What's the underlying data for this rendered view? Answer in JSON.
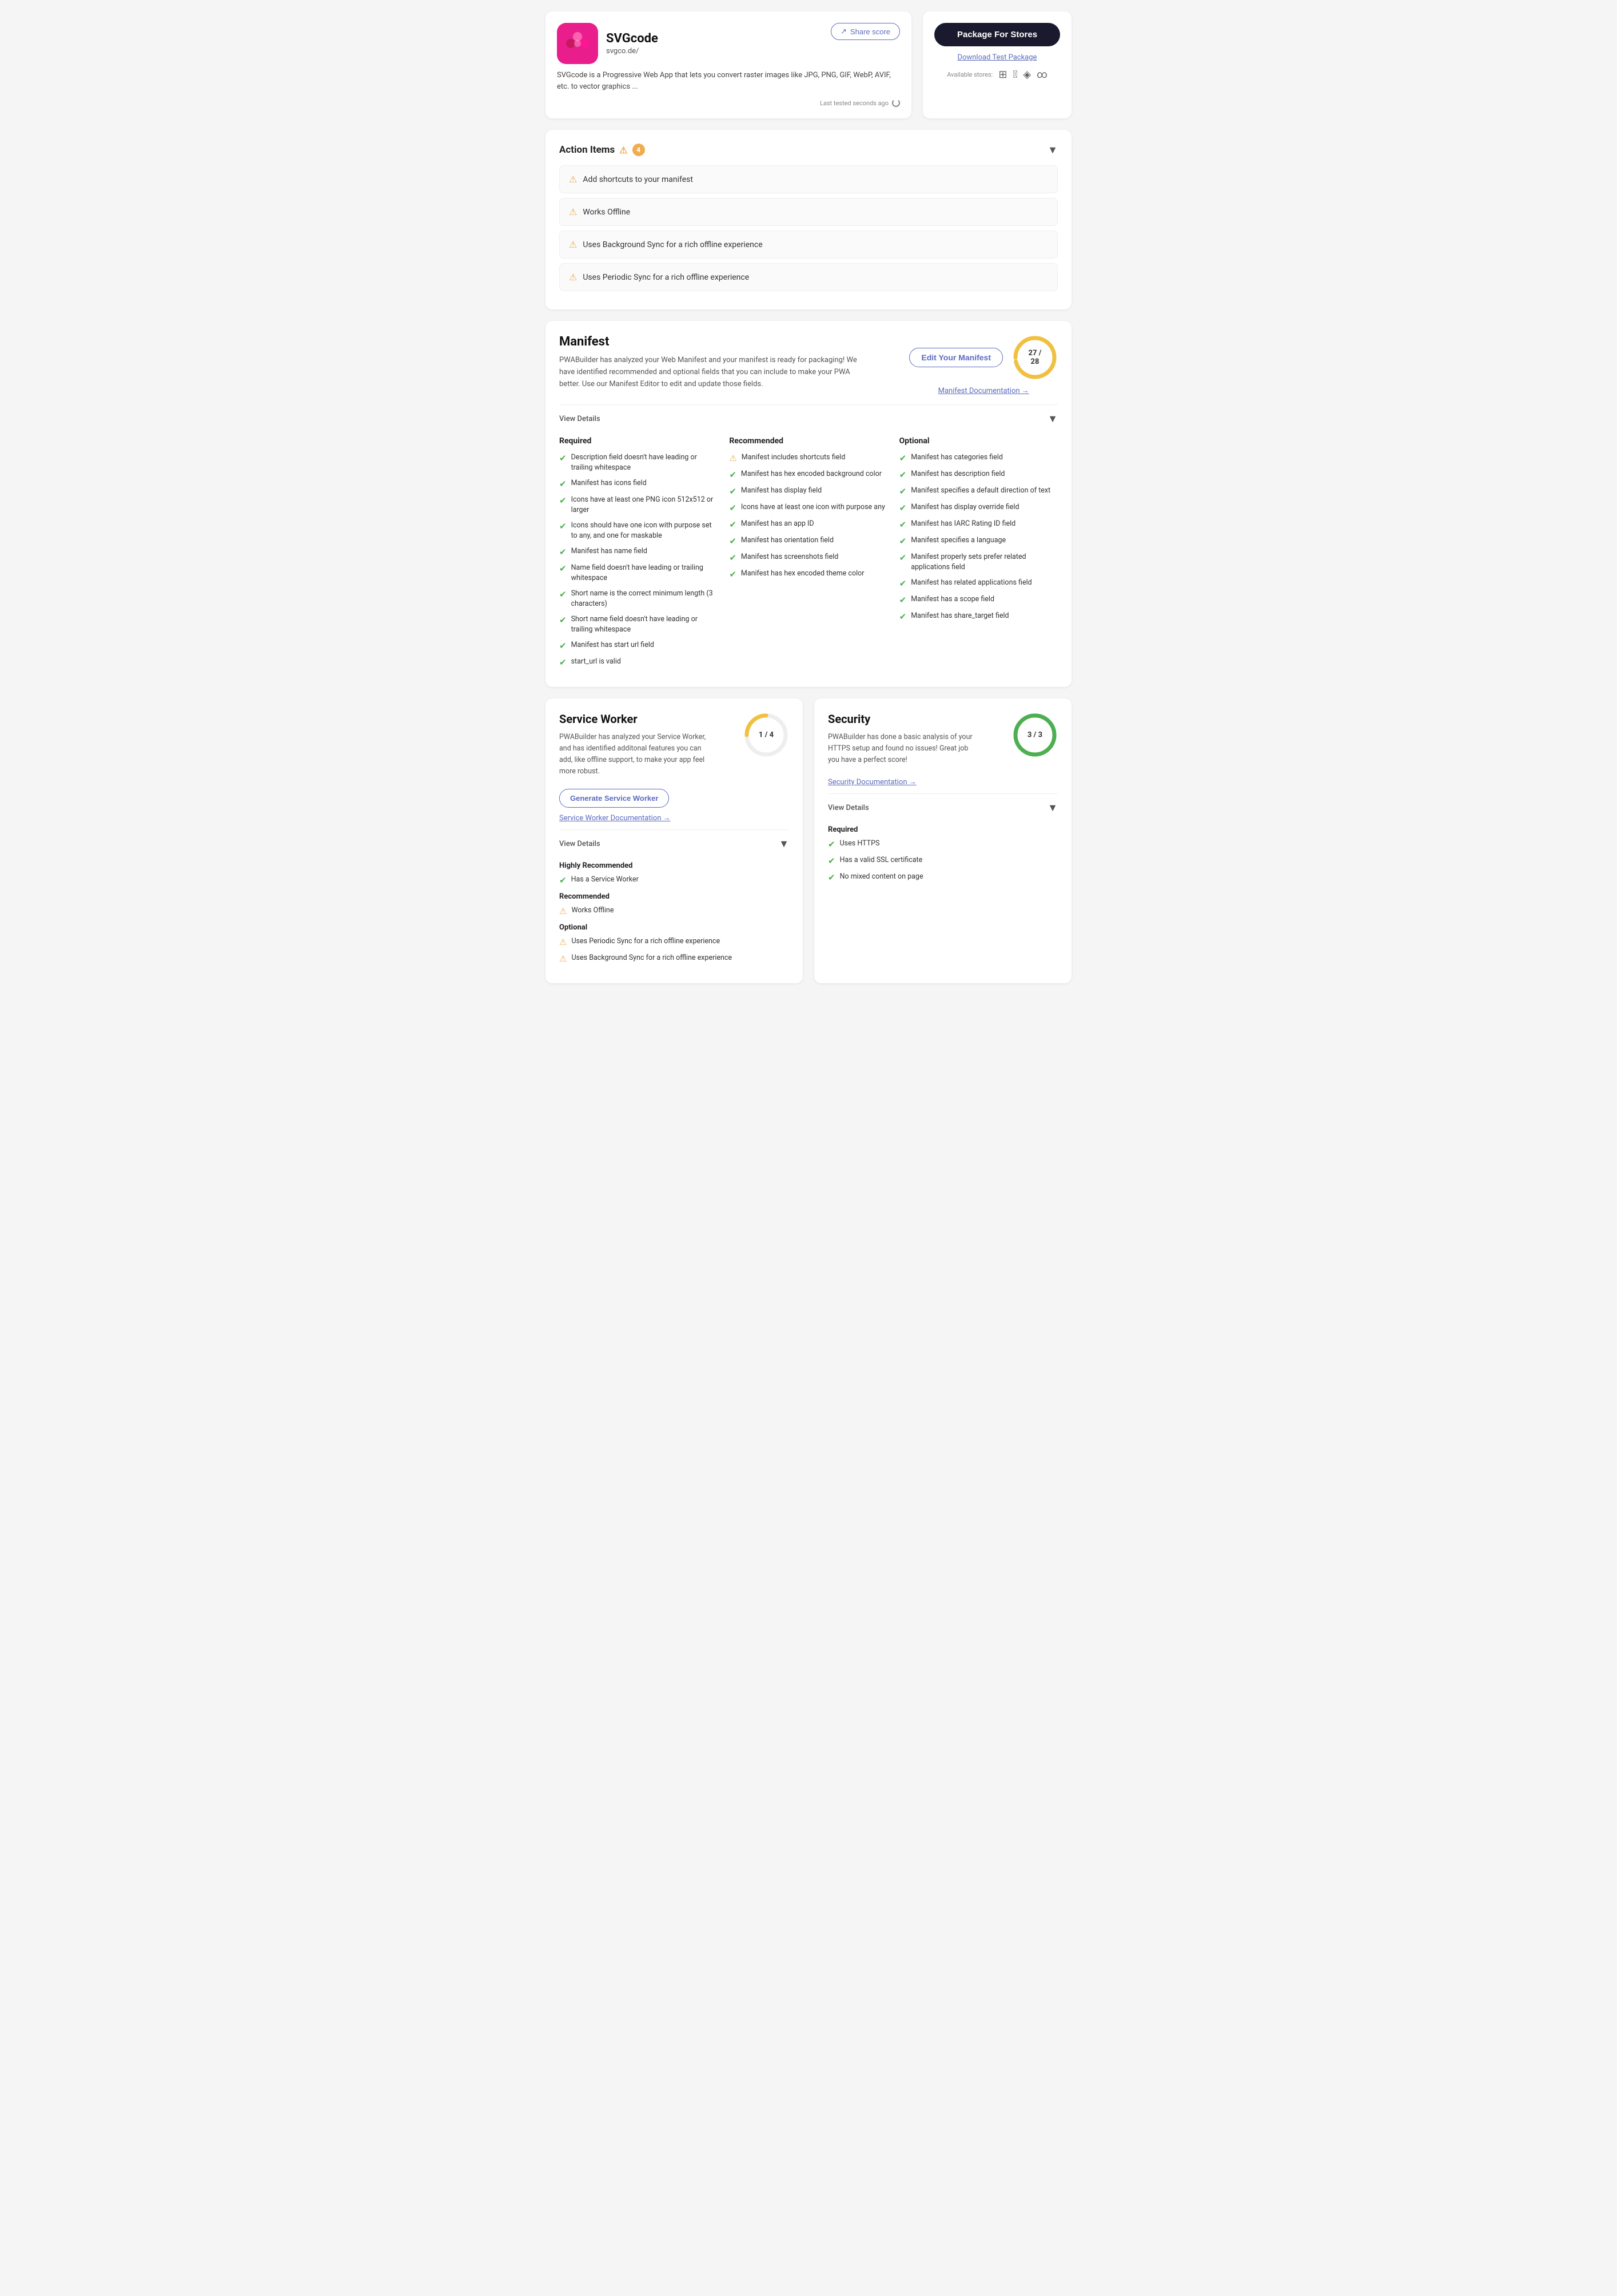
{
  "app": {
    "name": "SVGcode",
    "url": "svgco.de/",
    "description": "SVGcode is a Progressive Web App that lets you convert raster images like JPG, PNG, GIF, WebP, AVIF, etc. to vector graphics ...",
    "logo_emoji": "✿",
    "last_tested": "Last tested seconds ago"
  },
  "header": {
    "share_label": "Share score",
    "package_btn": "Package For Stores",
    "download_link": "Download Test Package",
    "available_stores_label": "Available stores:"
  },
  "action_items": {
    "title": "Action Items",
    "count": "4",
    "items": [
      {
        "text": "Add shortcuts to your manifest"
      },
      {
        "text": "Works Offline"
      },
      {
        "text": "Uses Background Sync for a rich offline experience"
      },
      {
        "text": "Uses Periodic Sync for a rich offline experience"
      }
    ]
  },
  "manifest": {
    "title": "Manifest",
    "description": "PWABuilder has analyzed your Web Manifest and your manifest is ready for packaging! We have identified recommended and optional fields that you can include to make your PWA better. Use our Manifest Editor to edit and update those fields.",
    "edit_btn": "Edit Your Manifest",
    "doc_link": "Manifest Documentation →",
    "score": "27 / 28",
    "score_current": 27,
    "score_max": 28,
    "view_details": "View Details",
    "required": {
      "title": "Required",
      "items": [
        {
          "status": "check",
          "text": "Description field doesn't have leading or trailing whitespace"
        },
        {
          "status": "check",
          "text": "Manifest has icons field"
        },
        {
          "status": "check",
          "text": "Icons have at least one PNG icon 512x512 or larger"
        },
        {
          "status": "check",
          "text": "Icons should have one icon with purpose set to any, and one for maskable"
        },
        {
          "status": "check",
          "text": "Manifest has name field"
        },
        {
          "status": "check",
          "text": "Name field doesn't have leading or trailing whitespace"
        },
        {
          "status": "check",
          "text": "Short name is the correct minimum length (3 characters)"
        },
        {
          "status": "check",
          "text": "Short name field doesn't have leading or trailing whitespace"
        },
        {
          "status": "check",
          "text": "Manifest has start url field"
        },
        {
          "status": "check",
          "text": "start_url is valid"
        }
      ]
    },
    "recommended": {
      "title": "Recommended",
      "items": [
        {
          "status": "warn",
          "text": "Manifest includes shortcuts field"
        },
        {
          "status": "check",
          "text": "Manifest has hex encoded background color"
        },
        {
          "status": "check",
          "text": "Manifest has display field"
        },
        {
          "status": "check",
          "text": "Icons have at least one icon with purpose any"
        },
        {
          "status": "check",
          "text": "Manifest has an app ID"
        },
        {
          "status": "check",
          "text": "Manifest has orientation field"
        },
        {
          "status": "check",
          "text": "Manifest has screenshots field"
        },
        {
          "status": "check",
          "text": "Manifest has hex encoded theme color"
        }
      ]
    },
    "optional": {
      "title": "Optional",
      "items": [
        {
          "status": "check",
          "text": "Manifest has categories field"
        },
        {
          "status": "check",
          "text": "Manifest has description field"
        },
        {
          "status": "check",
          "text": "Manifest specifies a default direction of text"
        },
        {
          "status": "check",
          "text": "Manifest has display override field"
        },
        {
          "status": "check",
          "text": "Manifest has IARC Rating ID field"
        },
        {
          "status": "check",
          "text": "Manifest specifies a language"
        },
        {
          "status": "check",
          "text": "Manifest properly sets prefer related applications field"
        },
        {
          "status": "check",
          "text": "Manifest has related applications field"
        },
        {
          "status": "check",
          "text": "Manifest has a scope field"
        },
        {
          "status": "check",
          "text": "Manifest has share_target field"
        }
      ]
    }
  },
  "service_worker": {
    "title": "Service Worker",
    "description": "PWABuilder has analyzed your Service Worker, and has identified additonal features you can add, like offline support, to make your app feel more robust.",
    "score": "1 / 4",
    "score_current": 1,
    "score_max": 4,
    "generate_btn": "Generate Service Worker",
    "doc_link": "Service Worker Documentation →",
    "view_details": "View Details",
    "highly_recommended": {
      "title": "Highly Recommended",
      "items": [
        {
          "status": "check",
          "text": "Has a Service Worker"
        }
      ]
    },
    "recommended": {
      "title": "Recommended",
      "items": [
        {
          "status": "warn",
          "text": "Works Offline"
        }
      ]
    },
    "optional": {
      "title": "Optional",
      "items": [
        {
          "status": "warn",
          "text": "Uses Periodic Sync for a rich offline experience"
        },
        {
          "status": "warn",
          "text": "Uses Background Sync for a rich offline experience"
        }
      ]
    }
  },
  "security": {
    "title": "Security",
    "description": "PWABuilder has done a basic analysis of your HTTPS setup and found no issues! Great job you have a perfect score!",
    "score": "3 / 3",
    "score_current": 3,
    "score_max": 3,
    "doc_link": "Security Documentation →",
    "view_details": "View Details",
    "required": {
      "title": "Required",
      "items": [
        {
          "status": "check",
          "text": "Uses HTTPS"
        },
        {
          "status": "check",
          "text": "Has a valid SSL certificate"
        },
        {
          "status": "check",
          "text": "No mixed content on page"
        }
      ]
    }
  }
}
